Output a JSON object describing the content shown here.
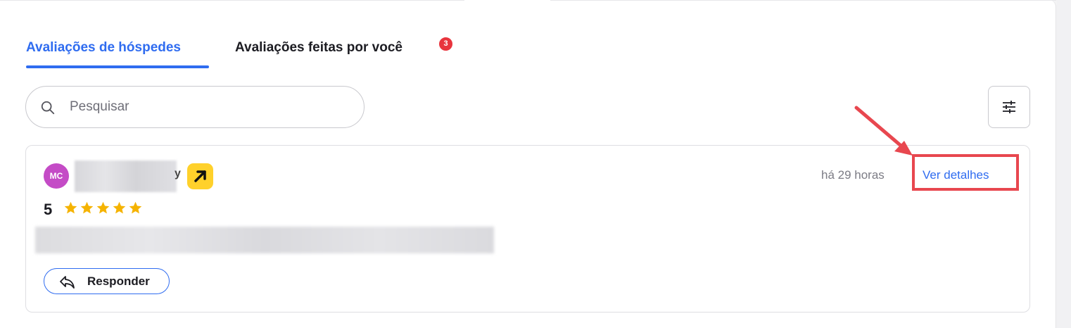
{
  "tabs": {
    "guest_reviews": "Avaliações de hóspedes",
    "your_reviews": "Avaliações feitas por você",
    "your_reviews_badge": "3"
  },
  "search": {
    "placeholder": "Pesquisar"
  },
  "filter": {
    "icon": "sliders-icon"
  },
  "review": {
    "avatar_initials": "MC",
    "name_tail": "y",
    "rating": "5",
    "stars": 5,
    "time_ago": "há 29 horas",
    "details_link": "Ver detalhes",
    "reply_label": "Responder"
  },
  "colors": {
    "accent": "#2f6cf0",
    "badge": "#e8343d",
    "avatar": "#c44bc6",
    "source_icon": "#ffd12b",
    "star": "#f5b300",
    "highlight": "#e8474f"
  }
}
